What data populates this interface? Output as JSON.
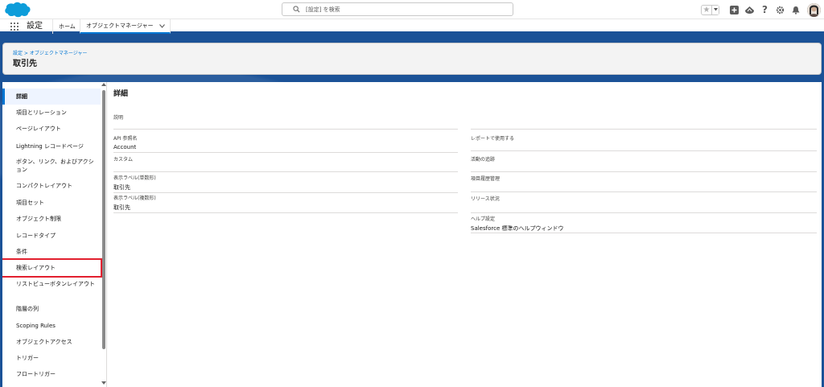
{
  "header": {
    "search_placeholder": "[設定] を検索",
    "logo_icon": "salesforce-cloud-icon",
    "icons": [
      "star-icon",
      "add-icon",
      "trailhead-icon",
      "help-icon",
      "gear-icon",
      "bell-icon"
    ]
  },
  "nav": {
    "app_name": "設定",
    "home_label": "ホーム",
    "object_manager_label": "オブジェクトマネージャー"
  },
  "page": {
    "breadcrumb": "設定 > オブジェクトマネージャー",
    "title": "取引先"
  },
  "sidebar": {
    "items": [
      {
        "label": "詳細"
      },
      {
        "label": "項目とリレーション"
      },
      {
        "label": "ページレイアウト"
      },
      {
        "label": "Lightning レコードページ"
      },
      {
        "label": "ボタン、リンク、およびアクション"
      },
      {
        "label": "コンパクトレイアウト"
      },
      {
        "label": "項目セット"
      },
      {
        "label": "オブジェクト制限"
      },
      {
        "label": "レコードタイプ"
      },
      {
        "label": "条件"
      },
      {
        "label": "検索レイアウト"
      },
      {
        "label": "リストビューボタンレイアウト"
      },
      {
        "label": "階層の列"
      },
      {
        "label": "Scoping Rules"
      },
      {
        "label": "オブジェクトアクセス"
      },
      {
        "label": "トリガー"
      },
      {
        "label": "フロートリガー"
      }
    ]
  },
  "details": {
    "section_title": "詳細",
    "description_label": "説明",
    "api_name_label": "API 参照名",
    "api_name_value": "Account",
    "custom_label": "カスタム",
    "singular_label": "表示ラベル(単数形)",
    "singular_value": "取引先",
    "plural_label": "表示ラベル(複数形)",
    "plural_value": "取引先",
    "reports_label": "レポートで使用する",
    "activities_label": "活動の追跡",
    "history_label": "項目履歴管理",
    "deploy_label": "リリース状況",
    "help_label": "ヘルプ設定",
    "help_value": "Salesforce 標準のヘルプウィンドウ"
  },
  "colors": {
    "brand_blue": "#1b5297",
    "link_blue": "#0176d3",
    "highlight_red": "#e2202f"
  }
}
